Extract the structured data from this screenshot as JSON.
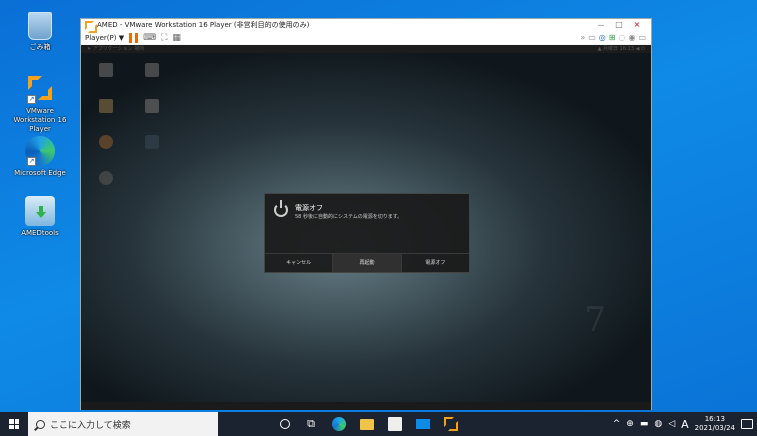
{
  "desktop": {
    "icons": [
      {
        "label": "ごみ箱",
        "icon": "recycle-bin-icon"
      },
      {
        "label": "VMware Workstation 16 Player",
        "icon": "vmware-icon"
      },
      {
        "label": "Microsoft Edge",
        "icon": "edge-icon"
      },
      {
        "label": "AMEDtools",
        "icon": "amed-installer-icon"
      }
    ]
  },
  "window": {
    "title": "AMED - VMware Workstation 16 Player (非営利目的の使用のみ)",
    "minimize": "－",
    "maximize": "□",
    "close": "×",
    "player_menu": "Player(P) ▼",
    "toolbar_icons": [
      "pause-icon",
      "send-ctrl-alt-del-icon",
      "fullscreen-icon",
      "unity-icon"
    ]
  },
  "guest": {
    "topbar_left": "➤ アプリケーション  場所",
    "topbar_right": "▲  月曜日 16:13  ◀ ⏻",
    "win7_watermark": "7",
    "desktop_icons": [
      "",
      "",
      "",
      "",
      "",
      "",
      ""
    ]
  },
  "dialog": {
    "title": "電源オフ",
    "message": "58 秒後に自動的にシステムの電源を切ります。",
    "buttons": [
      "キャンセル",
      "再起動",
      "電源オフ"
    ]
  },
  "taskbar": {
    "search_placeholder": "ここに入力して検索",
    "time": "16:13",
    "date": "2021/03/24",
    "ime": "A",
    "tray": [
      "^",
      "⊕",
      "▬",
      "◍",
      "◁"
    ]
  }
}
